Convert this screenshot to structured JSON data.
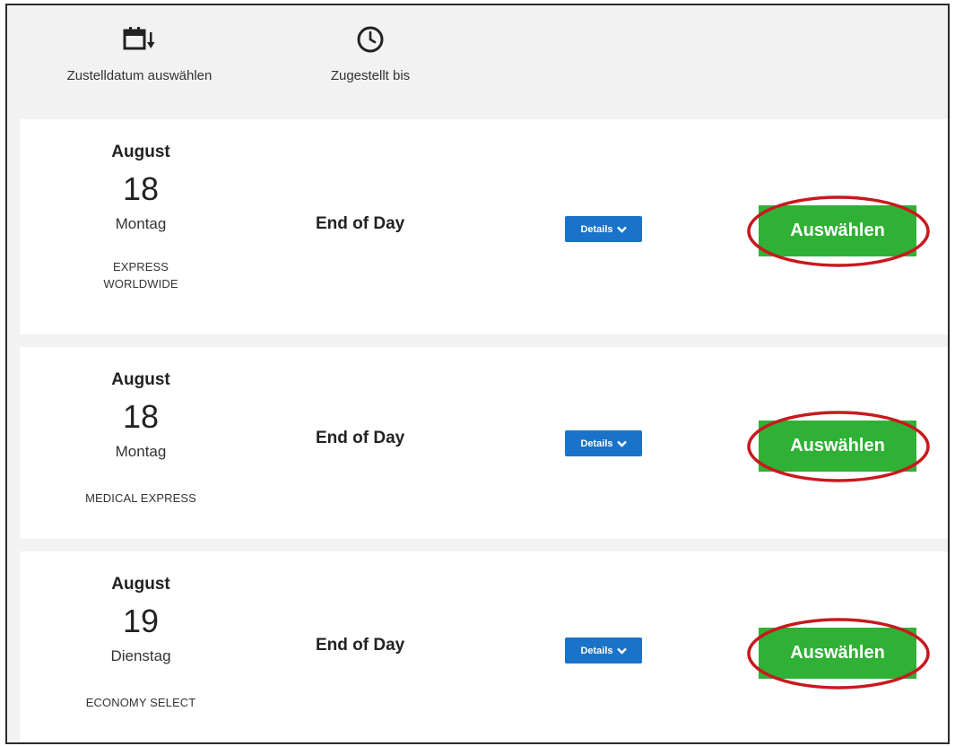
{
  "header": {
    "date_label": "Zustelldatum auswählen",
    "time_label": "Zugestellt bis",
    "date_icon": "calendar-sort-icon",
    "time_icon": "clock-icon"
  },
  "options": [
    {
      "month": "August",
      "day": "18",
      "weekday": "Montag",
      "service": "EXPRESS WORLDWIDE",
      "delivery": "End of Day",
      "details_label": "Details",
      "select_label": "Auswählen"
    },
    {
      "month": "August",
      "day": "18",
      "weekday": "Montag",
      "service": "MEDICAL EXPRESS",
      "delivery": "End of Day",
      "details_label": "Details",
      "select_label": "Auswählen"
    },
    {
      "month": "August",
      "day": "19",
      "weekday": "Dienstag",
      "service": "ECONOMY SELECT",
      "delivery": "End of Day",
      "details_label": "Details",
      "select_label": "Auswählen"
    }
  ],
  "colors": {
    "select_button": "#2fb135",
    "details_button": "#1a73c8",
    "highlight_ellipse": "#c8191e",
    "page_background": "#f2f2f2"
  }
}
